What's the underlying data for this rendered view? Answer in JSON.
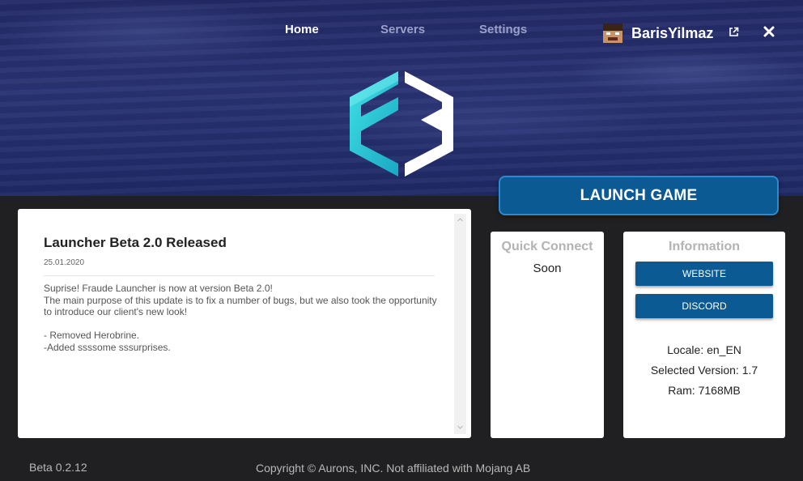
{
  "nav": {
    "items": [
      {
        "label": "Home",
        "active": true
      },
      {
        "label": "Servers",
        "active": false
      },
      {
        "label": "Settings",
        "active": false
      }
    ]
  },
  "user": {
    "name": "BarisYilmaz",
    "avatar_icon": "minecraft-skin-head-icon",
    "external_link_icon": "external-link-icon",
    "close_icon": "close-icon"
  },
  "logo_icon": "fraude-launcher-logo-icon",
  "launch": {
    "label": "LAUNCH GAME"
  },
  "news": {
    "title": "Launcher Beta 2.0 Released",
    "date": "25.01.2020",
    "body_lines": [
      "Suprise! Fraude Launcher is now at version Beta 2.0!",
      "The main purpose of this update is to fix a number of bugs, but we also took the opportunity to introduce our client's new look!",
      "",
      "- Removed Herobrine.",
      "-Added ssssome sssurprises."
    ]
  },
  "quick_connect": {
    "title": "Quick Connect",
    "status": "Soon"
  },
  "information": {
    "title": "Information",
    "website_label": "WEBSITE",
    "discord_label": "DISCORD",
    "locale": "Locale: en_EN",
    "selected_version": "Selected Version: 1.7",
    "ram": "Ram: 7168MB"
  },
  "footer": {
    "version": "Beta 0.2.12",
    "copyright": "Copyright © Aurons, INC. Not affiliated with Mojang AB"
  },
  "colors": {
    "accent_blue": "#0b5a93",
    "launch_border": "#2b8ad0",
    "hero_bg": "#232a66",
    "page_bg": "#202022",
    "logo_cyan": "#27c7d4",
    "logo_white": "#ffffff"
  }
}
